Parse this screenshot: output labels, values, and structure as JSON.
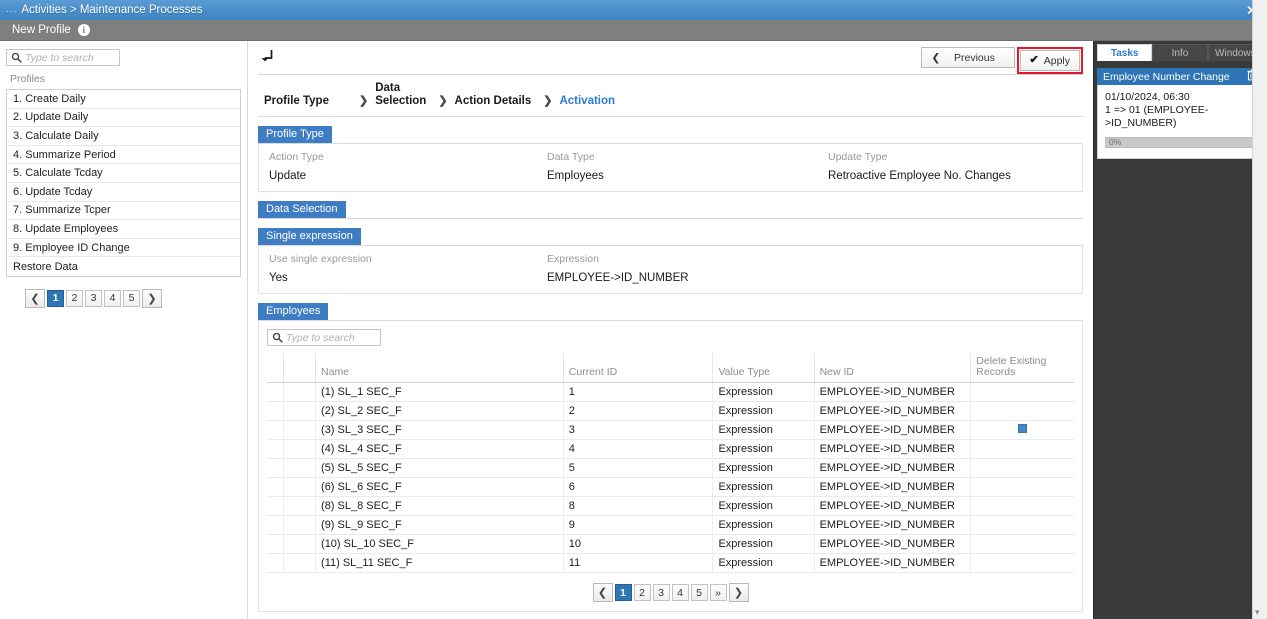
{
  "window": {
    "title": "Activities > Maintenance Processes",
    "dots": "...",
    "close_label": "✕"
  },
  "toolbar": {
    "label": "New Profile",
    "info_label": "i"
  },
  "sidebar": {
    "search_placeholder": "Type to search",
    "search_value": "",
    "caption": "Profiles",
    "items": [
      {
        "label": "1. Create Daily"
      },
      {
        "label": "2. Update Daily"
      },
      {
        "label": "3. Calculate Daily"
      },
      {
        "label": "4. Summarize Period"
      },
      {
        "label": "5. Calculate Tcday"
      },
      {
        "label": "6. Update Tcday"
      },
      {
        "label": "7. Summarize Tcper"
      },
      {
        "label": "8. Update Employees"
      },
      {
        "label": "9. Employee ID Change"
      },
      {
        "label": "Restore Data"
      }
    ],
    "pager": {
      "prev": "❮",
      "next": "❯",
      "pages": [
        "1",
        "2",
        "3",
        "4",
        "5"
      ],
      "active": "1"
    }
  },
  "main": {
    "back_icon": "return-arrow",
    "previous_label": "Previous",
    "apply_label": "Apply",
    "apply_check": "✔",
    "previous_chevron": "❮",
    "highlight_color": "#e8162a",
    "steps": [
      {
        "label": "Profile Type",
        "current": false,
        "sep": ""
      },
      {
        "label": "Data\nSelection",
        "current": false,
        "sep": "❯"
      },
      {
        "label": "Action Details",
        "current": false,
        "sep": "❯"
      },
      {
        "label": "Activation",
        "current": true,
        "sep": "❯"
      }
    ],
    "profile_type": {
      "title": "Profile Type",
      "fields": [
        {
          "label": "Action Type",
          "value": "Update"
        },
        {
          "label": "Data Type",
          "value": "Employees"
        },
        {
          "label": "Update Type",
          "value": "Retroactive Employee No. Changes"
        }
      ]
    },
    "data_selection": {
      "title": "Data Selection"
    },
    "single_expression": {
      "title": "Single expression",
      "fields": [
        {
          "label": "Use single expression",
          "value": "Yes"
        },
        {
          "label": "Expression",
          "value": "EMPLOYEE->ID_NUMBER"
        }
      ]
    },
    "employees": {
      "title": "Employees",
      "search_placeholder": "Type to search",
      "search_value": "",
      "columns": [
        "",
        "",
        "Name",
        "Current ID",
        "Value Type",
        "New ID",
        "Delete Existing Records"
      ],
      "rows": [
        {
          "name": "(1) SL_1 SEC_F",
          "current_id": "1",
          "value_type": "Expression",
          "new_id": "EMPLOYEE->ID_NUMBER",
          "delete_existing": false
        },
        {
          "name": "(2) SL_2 SEC_F",
          "current_id": "2",
          "value_type": "Expression",
          "new_id": "EMPLOYEE->ID_NUMBER",
          "delete_existing": false
        },
        {
          "name": "(3) SL_3 SEC_F",
          "current_id": "3",
          "value_type": "Expression",
          "new_id": "EMPLOYEE->ID_NUMBER",
          "delete_existing": true
        },
        {
          "name": "(4) SL_4 SEC_F",
          "current_id": "4",
          "value_type": "Expression",
          "new_id": "EMPLOYEE->ID_NUMBER",
          "delete_existing": false
        },
        {
          "name": "(5) SL_5 SEC_F",
          "current_id": "5",
          "value_type": "Expression",
          "new_id": "EMPLOYEE->ID_NUMBER",
          "delete_existing": false
        },
        {
          "name": "(6) SL_6 SEC_F",
          "current_id": "6",
          "value_type": "Expression",
          "new_id": "EMPLOYEE->ID_NUMBER",
          "delete_existing": false
        },
        {
          "name": "(8) SL_8 SEC_F",
          "current_id": "8",
          "value_type": "Expression",
          "new_id": "EMPLOYEE->ID_NUMBER",
          "delete_existing": false
        },
        {
          "name": "(9) SL_9 SEC_F",
          "current_id": "9",
          "value_type": "Expression",
          "new_id": "EMPLOYEE->ID_NUMBER",
          "delete_existing": false
        },
        {
          "name": "(10) SL_10 SEC_F",
          "current_id": "10",
          "value_type": "Expression",
          "new_id": "EMPLOYEE->ID_NUMBER",
          "delete_existing": false
        },
        {
          "name": "(11) SL_11 SEC_F",
          "current_id": "11",
          "value_type": "Expression",
          "new_id": "EMPLOYEE->ID_NUMBER",
          "delete_existing": false
        }
      ],
      "pager": {
        "prev": "❮",
        "next": "❯",
        "pages": [
          "1",
          "2",
          "3",
          "4",
          "5",
          "»"
        ],
        "active": "1"
      }
    }
  },
  "right_panel": {
    "tabs": [
      {
        "label": "Tasks",
        "active": true
      },
      {
        "label": "Info",
        "active": false
      },
      {
        "label": "Windows",
        "active": false
      }
    ],
    "task": {
      "title": "Employee Number Change",
      "delete_icon": "trash-icon",
      "timestamp": "01/10/2024, 06:30",
      "detail": "1 => 01 (EMPLOYEE->ID_NUMBER)",
      "progress_label": "0%",
      "progress_percent": 0
    }
  }
}
